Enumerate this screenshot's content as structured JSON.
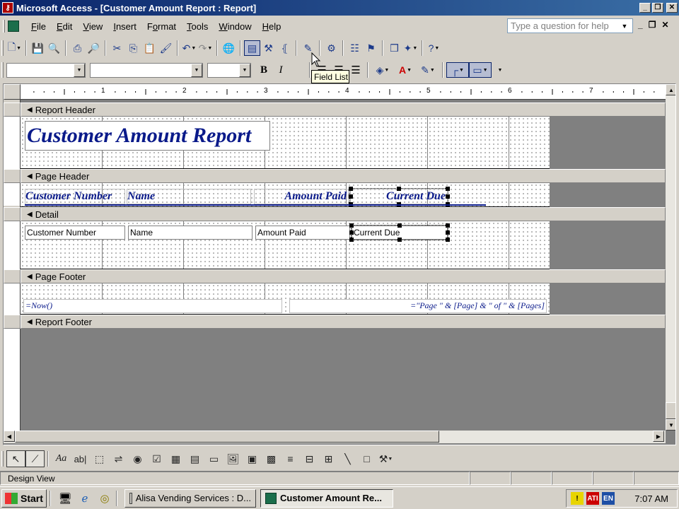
{
  "window": {
    "title": "Microsoft Access - [Customer Amount Report : Report]"
  },
  "menubar": {
    "items": [
      {
        "label": "File",
        "accel": "F",
        "rest": "ile"
      },
      {
        "label": "Edit",
        "accel": "E",
        "rest": "dit"
      },
      {
        "label": "View",
        "accel": "V",
        "rest": "iew"
      },
      {
        "label": "Insert",
        "accel": "I",
        "rest": "nsert"
      },
      {
        "label": "Format",
        "accel": "o",
        "pre": "F",
        "rest": "rmat"
      },
      {
        "label": "Tools",
        "accel": "T",
        "rest": "ools"
      },
      {
        "label": "Window",
        "accel": "W",
        "rest": "indow"
      },
      {
        "label": "Help",
        "accel": "H",
        "rest": "elp"
      }
    ],
    "help_placeholder": "Type a question for help"
  },
  "tooltip": {
    "text": "Field List"
  },
  "ruler": {
    "numbers": [
      "1",
      "2",
      "3",
      "4",
      "5",
      "6",
      "7"
    ]
  },
  "sections": {
    "report_header": "Report Header",
    "page_header": "Page Header",
    "detail": "Detail",
    "page_footer": "Page Footer",
    "report_footer": "Report Footer"
  },
  "report_header": {
    "title_label": "Customer Amount Report"
  },
  "page_header": {
    "labels": [
      "Customer Number",
      "Name",
      "Amount Paid",
      "Current Due"
    ]
  },
  "detail": {
    "textboxes": [
      "Customer Number",
      "Name",
      "Amount Paid",
      "Current Due"
    ]
  },
  "page_footer": {
    "now_expr": "=Now()",
    "page_expr": "=\"Page \" & [Page] & \" of \" & [Pages]"
  },
  "statusbar": {
    "mode": "Design View"
  },
  "taskbar": {
    "start": "Start",
    "tasks": [
      "Alisa Vending Services : D...",
      "Customer Amount Re..."
    ],
    "tray_lang": "EN",
    "clock": "7:07 AM"
  }
}
